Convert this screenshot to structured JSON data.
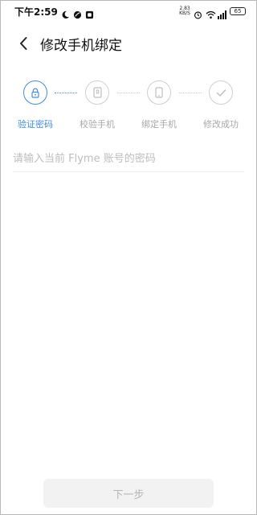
{
  "status_bar": {
    "time": "下午2:59",
    "net_speed_value": "2.83",
    "net_speed_unit": "KB/S",
    "battery": "65",
    "icons": [
      "moon-icon",
      "leaf-icon",
      "app-icon",
      "alarm-icon",
      "wifi-icon",
      "signal-icon",
      "battery-icon"
    ]
  },
  "header": {
    "title": "修改手机绑定",
    "back_icon": "back-arrow-icon"
  },
  "stepper": {
    "steps": [
      {
        "label": "验证密码",
        "icon": "lock-icon",
        "active": true
      },
      {
        "label": "校验手机",
        "icon": "sim-card-icon",
        "active": false
      },
      {
        "label": "绑定手机",
        "icon": "phone-icon",
        "active": false
      },
      {
        "label": "修改成功",
        "icon": "check-icon",
        "active": false
      }
    ],
    "active_color": "#3f8ce8",
    "inactive_color": "#cfcfcf"
  },
  "form": {
    "password_placeholder": "请输入当前 Flyme 账号的密码",
    "password_value": ""
  },
  "footer": {
    "next_label": "下一步",
    "next_enabled": false
  }
}
